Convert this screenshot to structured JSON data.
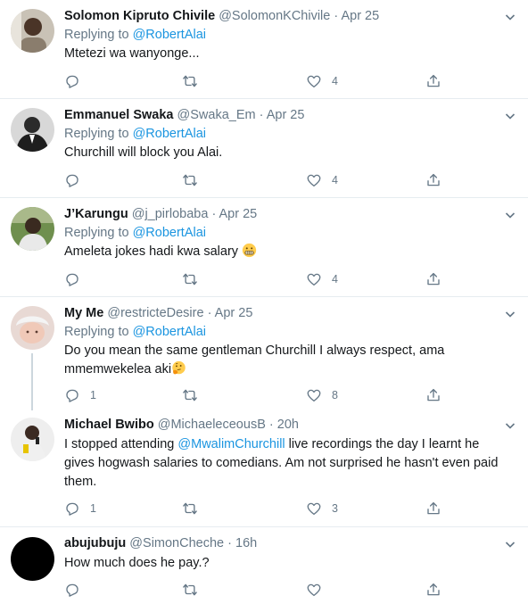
{
  "tweets": [
    {
      "name": "Solomon Kipruto Chivile",
      "handle": "@SolomonKChivile",
      "time": "Apr 25",
      "replying_label": "Replying to",
      "replying_to": "@RobertAlai",
      "text_parts": [
        "Mtetezi wa wanyonge..."
      ],
      "reply_count": "",
      "retweet_count": "",
      "like_count": "4",
      "avatar_icon": "avatar-man-icon"
    },
    {
      "name": "Emmanuel Swaka",
      "handle": "@Swaka_Em",
      "time": "Apr 25",
      "replying_label": "Replying to",
      "replying_to": "@RobertAlai",
      "text_parts": [
        "Churchill will block you Alai."
      ],
      "reply_count": "",
      "retweet_count": "",
      "like_count": "4",
      "avatar_icon": "avatar-man-suit-icon"
    },
    {
      "name": "J’Karungu",
      "handle": "@j_pirlobaba",
      "time": "Apr 25",
      "replying_label": "Replying to",
      "replying_to": "@RobertAlai",
      "text_parts": [
        "Ameleta jokes hadi kwa salary "
      ],
      "emoji": "grimacing-face-icon",
      "reply_count": "",
      "retweet_count": "",
      "like_count": "4",
      "avatar_icon": "avatar-man-outdoor-icon"
    },
    {
      "name": "My Me",
      "handle": "@restricteDesire",
      "time": "Apr 25",
      "replying_label": "Replying to",
      "replying_to": "@RobertAlai",
      "text_parts": [
        "Do you mean the same gentleman Churchill I always respect, ama",
        "mmemwekelea aki"
      ],
      "emoji": "thinking-face-icon",
      "reply_count": "1",
      "retweet_count": "",
      "like_count": "8",
      "avatar_icon": "avatar-baby-icon"
    },
    {
      "name": "Michael Bwibo",
      "handle": "@MichaeleceousB",
      "time": "20h",
      "text_prefix": "I stopped attending ",
      "mention": "@MwalimChurchill",
      "text_suffix_line1": " live recordings the day I learnt he",
      "text_lines": [
        "gives hogwash salaries to comedians. Am not surprised he hasn't even paid",
        "them."
      ],
      "reply_count": "1",
      "retweet_count": "",
      "like_count": "3",
      "avatar_icon": "avatar-man-speaking-icon"
    },
    {
      "name": "abujubuju",
      "handle": "@SimonCheche",
      "time": "16h",
      "text_parts": [
        "How much does he pay.?"
      ],
      "reply_count": "",
      "retweet_count": "",
      "like_count": "",
      "avatar_icon": "avatar-black-icon"
    }
  ],
  "separator": "·",
  "colors": {
    "text": "#14171a",
    "muted": "#657786",
    "link": "#1b95e0",
    "divider": "#e6ecf0",
    "thread_line": "#ccd6dd"
  }
}
